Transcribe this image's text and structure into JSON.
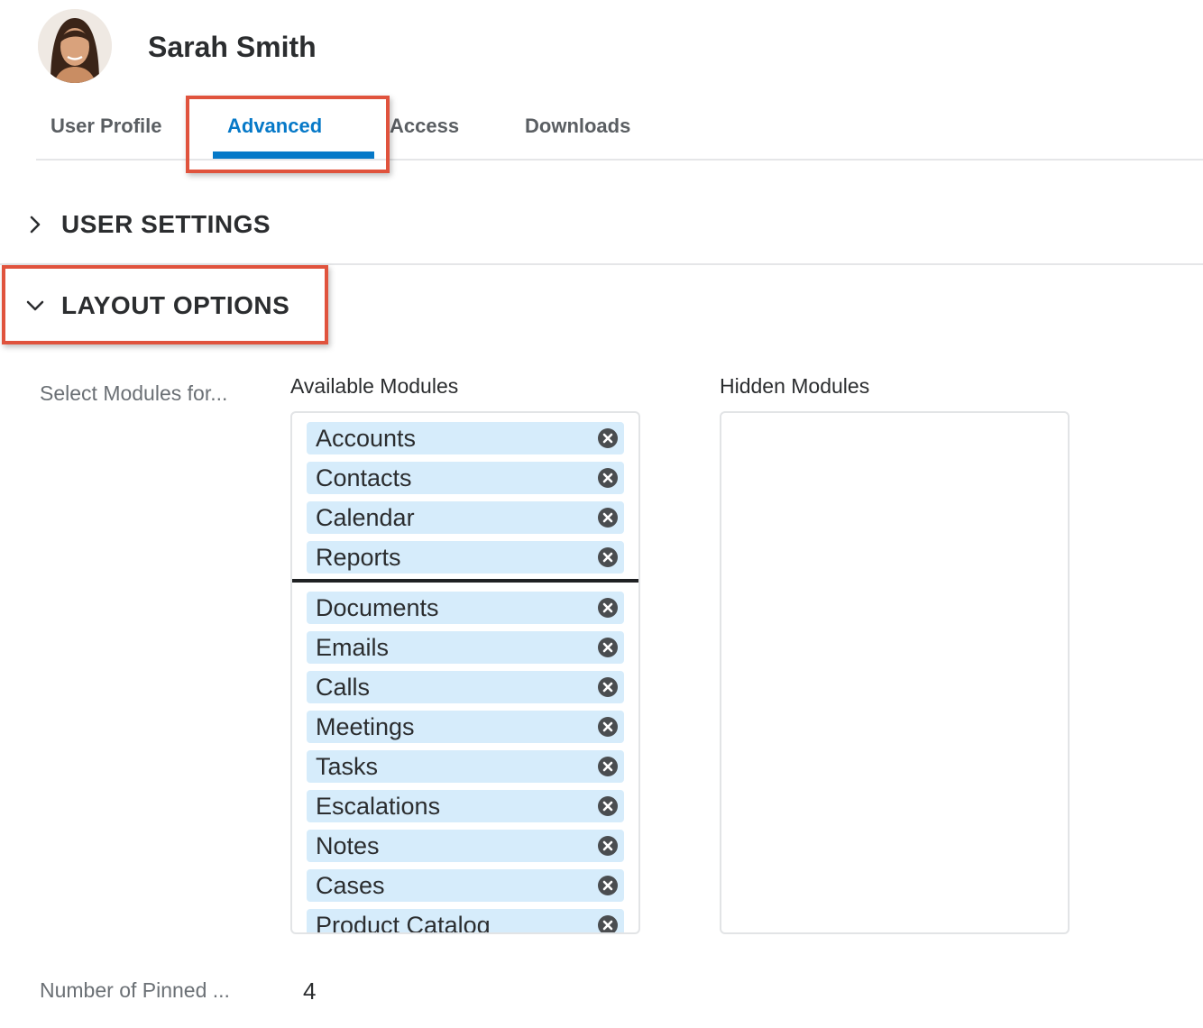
{
  "header": {
    "user_name": "Sarah Smith"
  },
  "tabs": [
    {
      "label": "User Profile",
      "active": false
    },
    {
      "label": "Advanced",
      "active": true
    },
    {
      "label": "Access",
      "active": false
    },
    {
      "label": "Downloads",
      "active": false
    }
  ],
  "sections": {
    "user_settings": {
      "title": "USER SETTINGS",
      "expanded": false
    },
    "layout_options": {
      "title": "LAYOUT OPTIONS",
      "expanded": true
    }
  },
  "layout": {
    "select_modules_label": "Select Modules for...",
    "available_label": "Available Modules",
    "hidden_label": "Hidden Modules",
    "pinned_modules": [
      "Accounts",
      "Contacts",
      "Calendar",
      "Reports"
    ],
    "other_modules": [
      "Documents",
      "Emails",
      "Calls",
      "Meetings",
      "Tasks",
      "Escalations",
      "Notes",
      "Cases",
      "Product Catalog"
    ],
    "hidden_modules": [],
    "pinned_count_label": "Number of Pinned ...",
    "pinned_count_value": "4"
  },
  "colors": {
    "accent": "#0679c8",
    "highlight": "#e0533d",
    "pill_bg": "#d6ecfb"
  },
  "icons": {
    "expand": "chevron-right-icon",
    "collapse": "chevron-down-icon",
    "remove": "close-circle-icon"
  }
}
